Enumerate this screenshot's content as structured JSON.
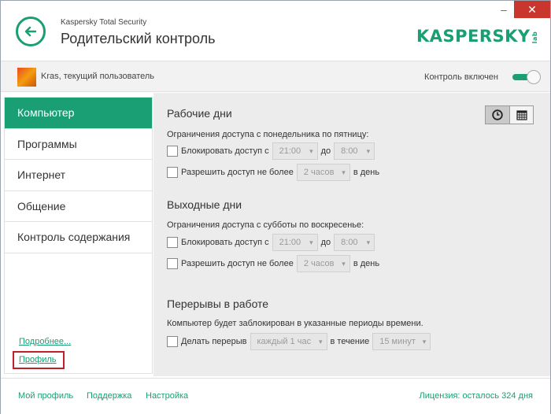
{
  "header": {
    "subtitle": "Kaspersky Total Security",
    "title": "Родительский контроль",
    "logo": "KASPERSKY",
    "logo_suffix": "lab",
    "minimize": "–",
    "close": "✕"
  },
  "userbar": {
    "user": "Kras, текущий пользователь",
    "control_status": "Контроль включен"
  },
  "sidebar": {
    "items": [
      "Компьютер",
      "Программы",
      "Интернет",
      "Общение",
      "Контроль содержания"
    ],
    "more_link": "Подробнее...",
    "profile_link": "Профиль"
  },
  "workdays": {
    "title": "Рабочие дни",
    "desc": "Ограничения доступа с понедельника по пятницу:",
    "block_label": "Блокировать доступ с",
    "block_from": "21:00",
    "to_label": "до",
    "block_to": "8:00",
    "allow_label": "Разрешить доступ не более",
    "allow_value": "2 часов",
    "per_day": "в день"
  },
  "weekend": {
    "title": "Выходные дни",
    "desc": "Ограничения доступа с субботы по воскресенье:",
    "block_label": "Блокировать доступ с",
    "block_from": "21:00",
    "to_label": "до",
    "block_to": "8:00",
    "allow_label": "Разрешить доступ не более",
    "allow_value": "2 часов",
    "per_day": "в день"
  },
  "breaks": {
    "title": "Перерывы в работе",
    "desc": "Компьютер будет заблокирован в указанные периоды времени.",
    "label": "Делать перерыв",
    "interval": "каждый 1 час",
    "during": "в течение",
    "duration": "15 минут"
  },
  "footer": {
    "my_profile": "Мой профиль",
    "support": "Поддержка",
    "settings": "Настройка",
    "license": "Лицензия: осталось 324 дня"
  },
  "colors": {
    "accent": "#1a9e74",
    "close": "#c9362e",
    "highlight": "#c0202a"
  }
}
